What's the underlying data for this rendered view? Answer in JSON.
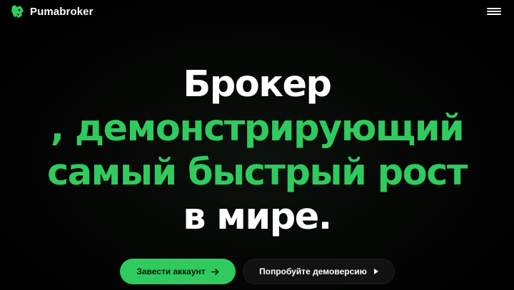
{
  "header": {
    "logo_text": "Pumabroker",
    "logo_icon": "puma-head-icon",
    "menu_icon": "hamburger-menu-icon"
  },
  "hero": {
    "line1": "Брокер",
    "line2": ", демонстрирующий",
    "line3": "самый быстрый рост",
    "line4": "в мире."
  },
  "cta": {
    "primary_label": "Завести аккаунт",
    "primary_icon": "arrow-right-icon",
    "secondary_label": "Попробуйте демоверсию",
    "secondary_icon": "play-triangle-icon"
  },
  "colors": {
    "accent": "#2fcb5e",
    "background": "#000000",
    "text": "#ffffff",
    "secondary_button": "#121212"
  }
}
